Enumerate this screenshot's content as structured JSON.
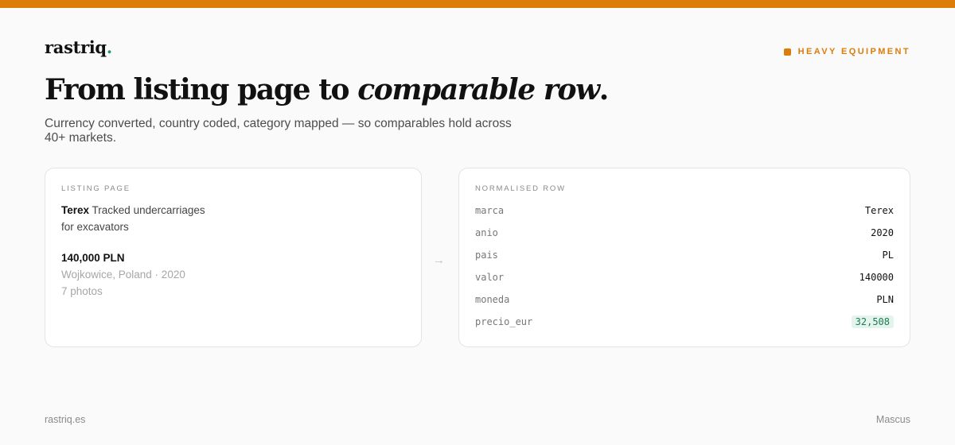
{
  "brand": {
    "name": "rastriq",
    "dot": "."
  },
  "category": "HEAVY EQUIPMENT",
  "headline": {
    "plain": "From listing page to ",
    "italic": "comparable row",
    "end": "."
  },
  "subtitle": "Currency converted, country coded, category mapped — so comparables hold across 40+ markets.",
  "listing": {
    "label": "LISTING PAGE",
    "brand": "Terex",
    "title": "Tracked undercarriages for excavators",
    "price": "140,000 PLN",
    "location": "Wojkowice, Poland · 2020",
    "photos": "7 photos"
  },
  "arrow": "→",
  "normalised": {
    "label": "NORMALISED ROW",
    "rows": [
      {
        "key": "marca",
        "value": "Terex"
      },
      {
        "key": "anio",
        "value": "2020"
      },
      {
        "key": "pais",
        "value": "PL"
      },
      {
        "key": "valor",
        "value": "140000"
      },
      {
        "key": "moneda",
        "value": "PLN"
      },
      {
        "key": "precio_eur",
        "value": "32,508"
      }
    ]
  },
  "footer": {
    "site": "rastriq.es",
    "source": "Mascus"
  },
  "colors": {
    "accent": "#dc7c0a",
    "green": "#1f9a6b",
    "highlight_bg": "#e3f4ec"
  }
}
